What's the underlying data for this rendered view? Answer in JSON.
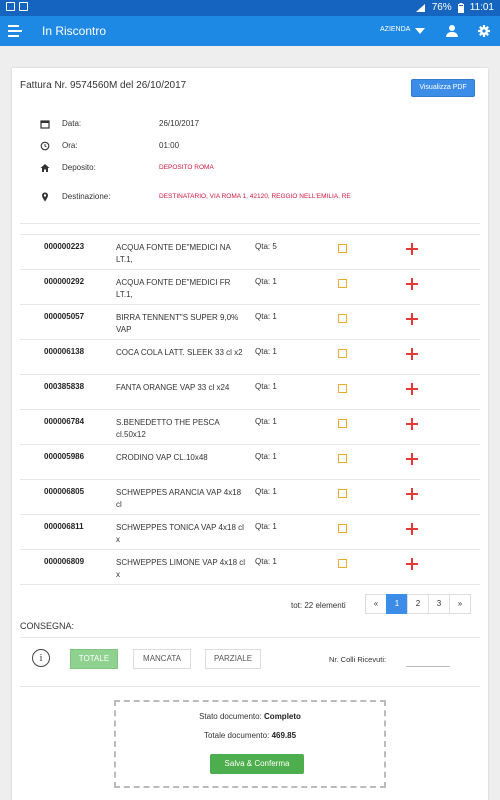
{
  "status_bar": {
    "battery": "76%",
    "time": "11:01"
  },
  "app_bar": {
    "title": "In Riscontro",
    "company_menu": "AZIENDA"
  },
  "invoice": {
    "title": "Fattura Nr. 9574560M del 26/10/2017",
    "pdf_button": "Visualizza PDF",
    "fields": {
      "date_label": "Data:",
      "date_value": "26/10/2017",
      "time_label": "Ora:",
      "time_value": "01:00",
      "warehouse_label": "Deposito:",
      "warehouse_value": "DEPOSITO ROMA",
      "destination_label": "Destinazione:",
      "destination_value": "DESTINATARIO, VIA ROMA 1, 42120, REGGIO NELL'EMILIA, RE"
    }
  },
  "items": [
    {
      "code": "000000223",
      "desc": "ACQUA FONTE DE\"MEDICI NA LT.1,",
      "qty": "Qta: 5"
    },
    {
      "code": "000000292",
      "desc": "ACQUA FONTE DE\"MEDICI FR LT.1,",
      "qty": "Qta: 1"
    },
    {
      "code": "000005057",
      "desc": "BIRRA TENNENT\"S SUPER 9,0% VAP",
      "qty": "Qta: 1"
    },
    {
      "code": "000006138",
      "desc": "COCA COLA LATT. SLEEK 33 cl x2",
      "qty": "Qta: 1"
    },
    {
      "code": "000385838",
      "desc": "FANTA ORANGE VAP 33 cl x24",
      "qty": "Qta: 1"
    },
    {
      "code": "000006784",
      "desc": "S.BENEDETTO THE PESCA cl.50x12",
      "qty": "Qta: 1"
    },
    {
      "code": "000005986",
      "desc": "CRODINO VAP CL.10x48",
      "qty": "Qta: 1"
    },
    {
      "code": "000006805",
      "desc": "SCHWEPPES ARANCIA VAP 4x18 cl",
      "qty": "Qta: 1"
    },
    {
      "code": "000006811",
      "desc": "SCHWEPPES TONICA VAP 4x18 cl x",
      "qty": "Qta: 1"
    },
    {
      "code": "000006809",
      "desc": "SCHWEPPES LIMONE VAP 4x18 cl x",
      "qty": "Qta: 1"
    }
  ],
  "pagination": {
    "total": "tot: 22 elementi",
    "prev": "«",
    "pages": [
      "1",
      "2",
      "3"
    ],
    "next": "»",
    "active_page": "1"
  },
  "delivery": {
    "label": "CONSEGNA:",
    "info_icon": "i",
    "options": [
      "TOTALE",
      "MANCATA",
      "PARZIALE"
    ],
    "selected": "TOTALE",
    "colli_label": "Nr. Colli Ricevuti:",
    "colli_value": ""
  },
  "summary": {
    "status_label": "Stato documento:",
    "status_value": "Completo",
    "total_label": "Totale documento:",
    "total_value": "469.85",
    "save_button": "Salva & Conferma"
  },
  "colors": {
    "appbar": "#1e88e5",
    "statusbar": "#1565c0",
    "primary_button": "#3b8de8",
    "checkbox": "#f0a830",
    "plus": "#e53935",
    "active_option": "#8fd18f",
    "save": "#4cae4c",
    "warehouse_text": "#d0153e"
  }
}
